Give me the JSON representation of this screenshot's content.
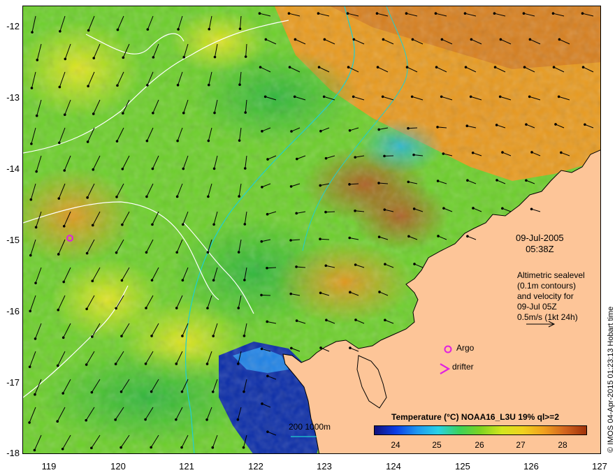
{
  "map": {
    "lat_ticks": [
      "-12",
      "-13",
      "-14",
      "-15",
      "-16",
      "-17",
      "-18"
    ],
    "lon_ticks": [
      "119",
      "120",
      "121",
      "122",
      "123",
      "124",
      "125",
      "126",
      "127"
    ],
    "lat_range": [
      -18,
      -11.75
    ],
    "lon_range": [
      118.6,
      127.0
    ]
  },
  "annotations": {
    "date": "09-Jul-2005",
    "time": "05:38Z",
    "info_lines": [
      "Altimetric sealevel",
      "(0.1m contours)",
      "and velocity for",
      "09-Jul 05Z",
      "0.5m/s (1kt 24h)"
    ],
    "argo_label": "Argo",
    "drifter_label": "drifter",
    "depth_label": "200  1000m",
    "credit": "© IMOS 04-Apr-2015 01:23:13 Hobart time"
  },
  "colorbar": {
    "title": "Temperature (°C) NOAA16_L3U 19% ql>=2",
    "ticks": [
      "24",
      "25",
      "26",
      "27",
      "28"
    ]
  },
  "colors": {
    "land": "#fdc598",
    "sst_cold": "#0a1e9a",
    "sst_warm": "#e07814",
    "argo": "#e020e0",
    "bathymetry": "#20d0d0",
    "contour": "#ffffff"
  }
}
